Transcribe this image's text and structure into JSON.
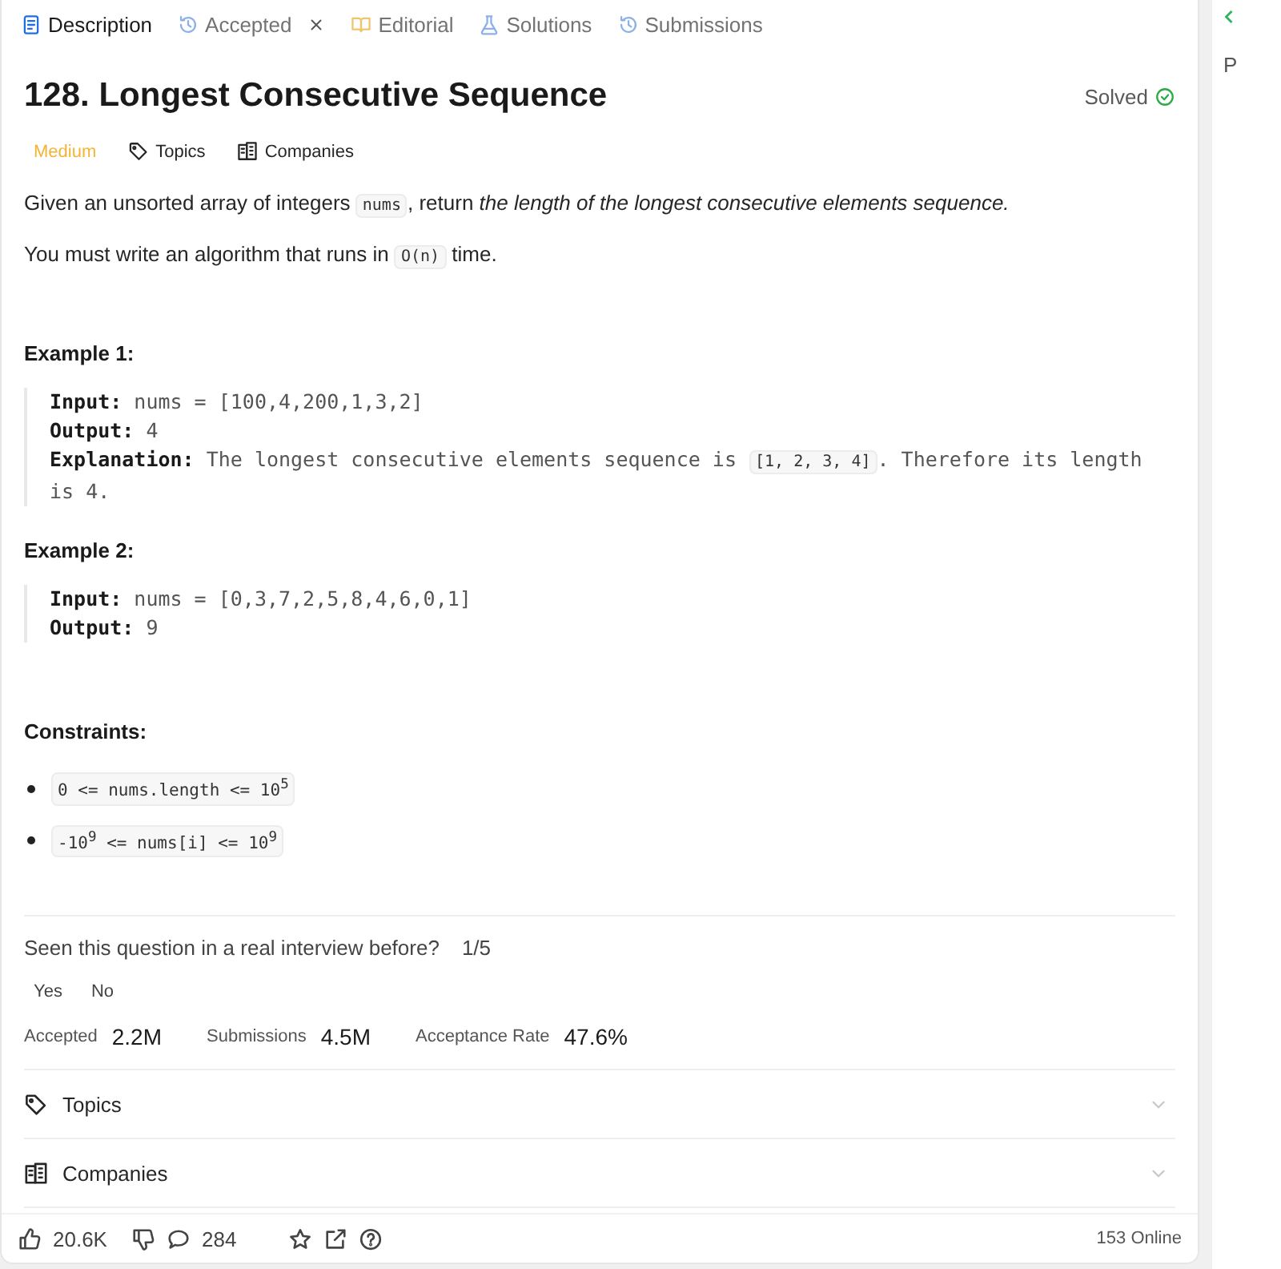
{
  "tabs": [
    {
      "label": "Description",
      "selected": true,
      "closable": false
    },
    {
      "label": "Accepted",
      "selected": false,
      "closable": true
    },
    {
      "label": "Editorial",
      "selected": false,
      "closable": false
    },
    {
      "label": "Solutions",
      "selected": false,
      "closable": false
    },
    {
      "label": "Submissions",
      "selected": false,
      "closable": false
    }
  ],
  "problem": {
    "title": "128. Longest Consecutive Sequence",
    "status": "Solved",
    "difficulty": "Medium",
    "tags": [
      "Topics",
      "Companies"
    ],
    "paragraphs": [
      [
        {
          "t": "Given an unsorted array of integers ",
          "code": false
        },
        {
          "t": "nums",
          "code": true
        },
        {
          "t": ", return *the length of the longest consecutive elements sequence.*",
          "code": false
        }
      ],
      [
        {
          "t": "You must write an algorithm that runs in ",
          "code": false
        },
        {
          "t": "O(n)",
          "code": true
        },
        {
          "t": " time.",
          "code": false
        }
      ]
    ],
    "examples": [
      {
        "title": "Example 1:",
        "lines": [
          [
            {
              "t": "**Input:** nums = [100,4,200,1,3,2]",
              "code": false
            }
          ],
          [
            {
              "t": "**Output:** 4",
              "code": false
            }
          ],
          [
            {
              "t": "**Explanation:** The longest consecutive elements sequence is ",
              "code": false
            },
            {
              "t": "[1, 2, 3, 4]",
              "code": true
            },
            {
              "t": ". Therefore its length is 4.",
              "code": false
            }
          ]
        ]
      },
      {
        "title": "Example 2:",
        "lines": [
          [
            {
              "t": "**Input:** nums = [0,3,7,2,5,8,4,6,0,1]",
              "code": false
            }
          ],
          [
            {
              "t": "**Output:** 9",
              "code": false
            }
          ]
        ]
      }
    ],
    "constraints_title": "Constraints:",
    "constraints": [
      "0 <= nums.length <= 10$^{5}$",
      "-10$^{9}$ <= nums[i] <= 10$^{9}$"
    ]
  },
  "interview": {
    "question": "Seen this question in a real interview before?",
    "count": "1/5",
    "answers": [
      "Yes",
      "No"
    ]
  },
  "stats": [
    {
      "label": "Accepted",
      "value": "2.2M"
    },
    {
      "label": "Submissions",
      "value": "4.5M"
    },
    {
      "label": "Acceptance Rate",
      "value": "47.6%"
    }
  ],
  "sections": [
    {
      "label": "Topics",
      "expanded": false
    },
    {
      "label": "Companies",
      "expanded": false
    }
  ],
  "footer": {
    "likes": "20.6K",
    "comments": "284",
    "online": "153 Online"
  },
  "side_panel": {
    "label": "P"
  }
}
